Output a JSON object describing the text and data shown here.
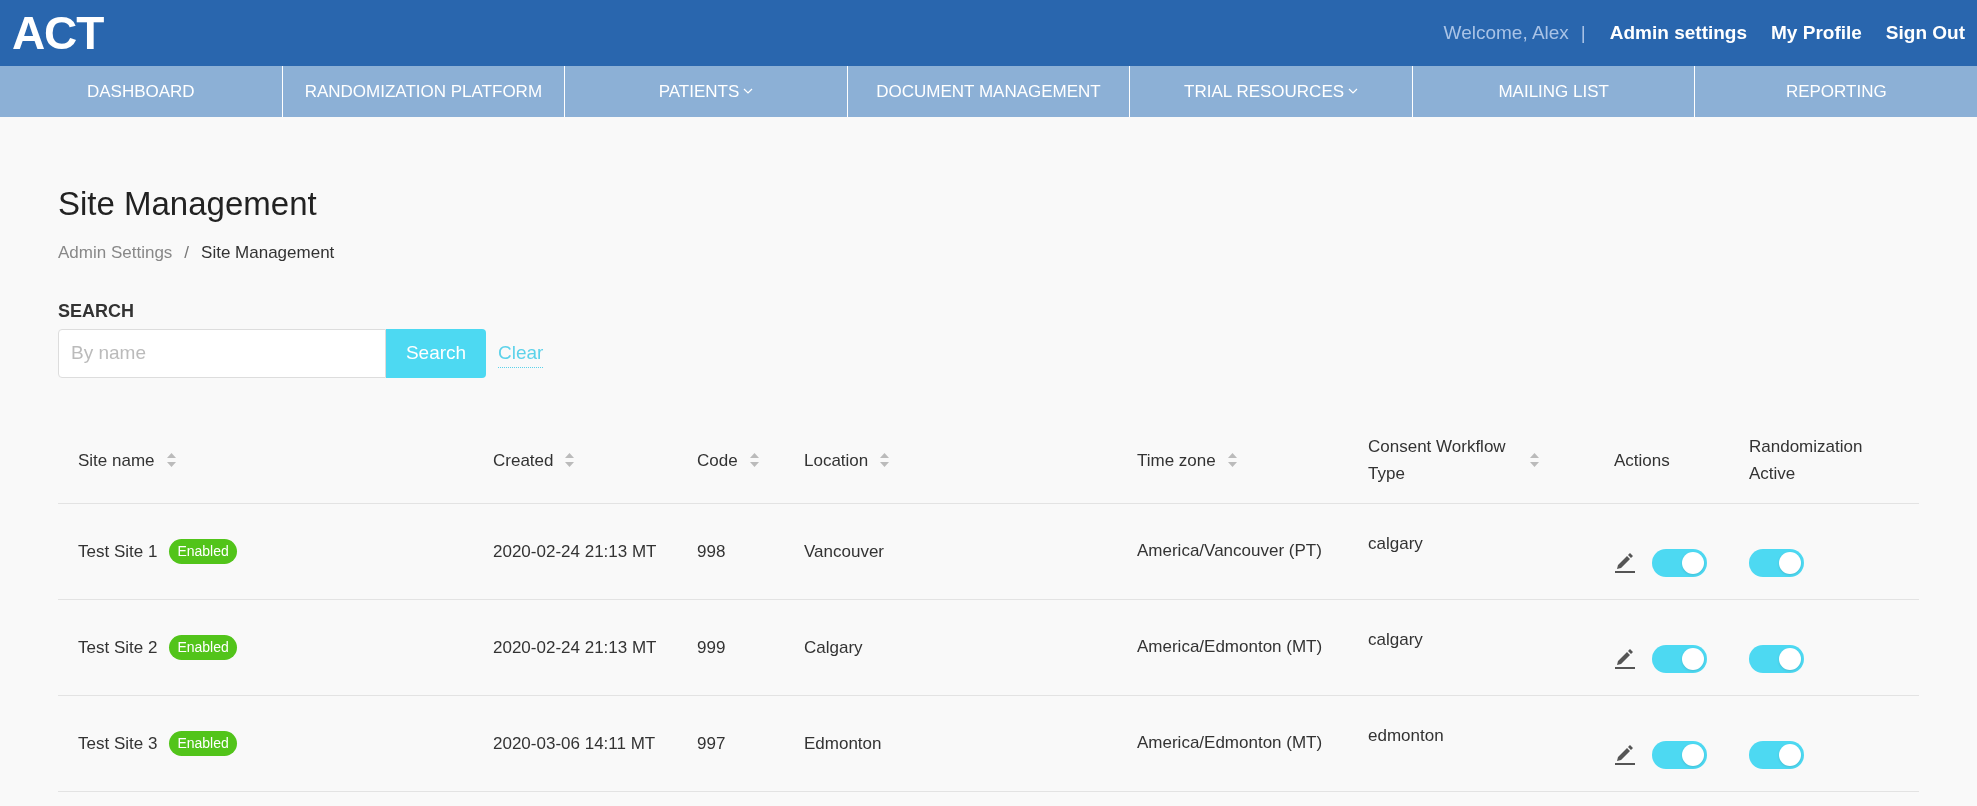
{
  "header": {
    "logo": "ACT",
    "welcome": "Welcome, Alex",
    "separator": "|",
    "links": [
      "Admin settings",
      "My Profile",
      "Sign Out"
    ]
  },
  "nav": [
    {
      "label": "DASHBOARD",
      "kind": "link"
    },
    {
      "label": "RANDOMIZATION PLATFORM",
      "kind": "link"
    },
    {
      "label": "PATIENTS",
      "kind": "dropdown"
    },
    {
      "label": "DOCUMENT MANAGEMENT",
      "kind": "link"
    },
    {
      "label": "TRIAL RESOURCES",
      "kind": "dropdown"
    },
    {
      "label": "MAILING LIST",
      "kind": "link"
    },
    {
      "label": "REPORTING",
      "kind": "link"
    }
  ],
  "page": {
    "title": "Site Management",
    "breadcrumb": [
      {
        "label": "Admin Settings",
        "selected": false
      },
      {
        "label": "Site Management",
        "selected": true
      }
    ],
    "breadcrumb_separator": "/"
  },
  "search": {
    "label": "SEARCH",
    "placeholder": "By name",
    "button": "Search",
    "clear": "Clear"
  },
  "table": {
    "columns": [
      {
        "label": "Site name",
        "kind": "sortable"
      },
      {
        "label": "Created",
        "kind": "sortable"
      },
      {
        "label": "Code",
        "kind": "sortable"
      },
      {
        "label": "Location",
        "kind": "sortable"
      },
      {
        "label": "Time zone",
        "kind": "sortable"
      },
      {
        "label": "Consent Workflow Type",
        "kind": "sortable"
      },
      {
        "label": "Actions",
        "kind": "plain"
      },
      {
        "label": "Randomization Active",
        "kind": "plain"
      }
    ],
    "rows": [
      {
        "site_name": "Test Site 1",
        "status": "Enabled",
        "created": "2020-02-24 21:13 MT",
        "code": "998",
        "location": "Vancouver",
        "time_zone": "America/Vancouver (PT)",
        "consent": "calgary",
        "enabled_on": true,
        "randomization_on": true
      },
      {
        "site_name": "Test Site 2",
        "status": "Enabled",
        "created": "2020-02-24 21:13 MT",
        "code": "999",
        "location": "Calgary",
        "time_zone": "America/Edmonton (MT)",
        "consent": "calgary",
        "enabled_on": true,
        "randomization_on": true
      },
      {
        "site_name": "Test Site 3",
        "status": "Enabled",
        "created": "2020-03-06 14:11 MT",
        "code": "997",
        "location": "Edmonton",
        "time_zone": "America/Edmonton (MT)",
        "consent": "edmonton",
        "enabled_on": true,
        "randomization_on": true
      }
    ]
  }
}
